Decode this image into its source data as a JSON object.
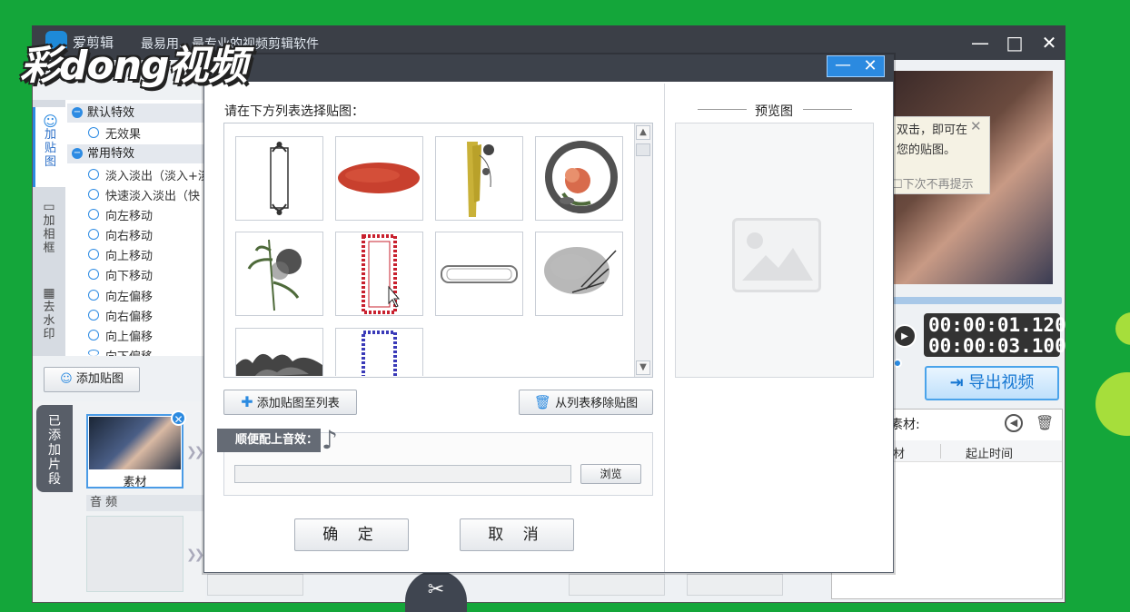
{
  "app": {
    "name": "爱剪辑",
    "slogan": "最易用、最专业的视频剪辑软件",
    "watermark": "彩dong视频"
  },
  "window_controls": {
    "minimize": "—",
    "maximize": "□",
    "close": "✕"
  },
  "dialog": {
    "title": "",
    "prompt": "请在下方列表选择贴图：",
    "add_to_list": "添加贴图至列表",
    "remove_from_list": "从列表移除贴图",
    "audio_label": "顺便配上音效：",
    "audio_path": "",
    "browse": "浏览",
    "ok": "确 定",
    "cancel": "取 消",
    "preview_title": "预览图",
    "minimize_icon": "—",
    "close_icon": "✕"
  },
  "sticker_thumbnails": [
    {
      "name": "frame-ornament-black",
      "color": "#333333"
    },
    {
      "name": "red-brush-stroke",
      "color": "#c8402e"
    },
    {
      "name": "yellow-brush-plant",
      "color": "#c9b138"
    },
    {
      "name": "ink-circle-flower",
      "color": "#d86b4c"
    },
    {
      "name": "ink-bamboo",
      "color": "#4e6a3a"
    },
    {
      "name": "red-pattern-frame",
      "color": "#c8202e"
    },
    {
      "name": "rounded-label-frame",
      "color": "#777777"
    },
    {
      "name": "ink-splash-grass",
      "color": "#666666"
    },
    {
      "name": "ink-landscape",
      "color": "#444444"
    },
    {
      "name": "blue-pattern-frame",
      "color": "#3a3ab8"
    }
  ],
  "sidebar": {
    "tabs": [
      "加贴图",
      "加相框",
      "去水印"
    ],
    "groups": [
      {
        "label": "默认特效",
        "items": [
          "无效果"
        ]
      },
      {
        "label": "常用特效",
        "items": [
          "淡入淡出（淡入+淡",
          "快速淡入淡出（快",
          "向左移动",
          "向右移动",
          "向上移动",
          "向下移动",
          "向左偏移",
          "向右偏移",
          "向上偏移",
          "向下偏移"
        ]
      }
    ],
    "add_sticker_button": "添加贴图"
  },
  "timeline": {
    "added_clips_tab": "已添加片段",
    "clip_label": "素材",
    "audio_label": "音 频",
    "scissors_icon": "✂"
  },
  "player": {
    "tooltip_lines": [
      "双击，即可在",
      "您的贴图。"
    ],
    "tooltip_checkbox": "下次不再提示",
    "time_current": "00:00:01.120",
    "time_total": "00:00:03.100",
    "export_button": "导出视频"
  },
  "material_panel": {
    "title": "素材:",
    "col1": "材",
    "col2": "起止时间"
  },
  "colors": {
    "desktop_green": "#14a63a",
    "accent_blue": "#2b8ae0",
    "title_dark": "#3d424b"
  }
}
